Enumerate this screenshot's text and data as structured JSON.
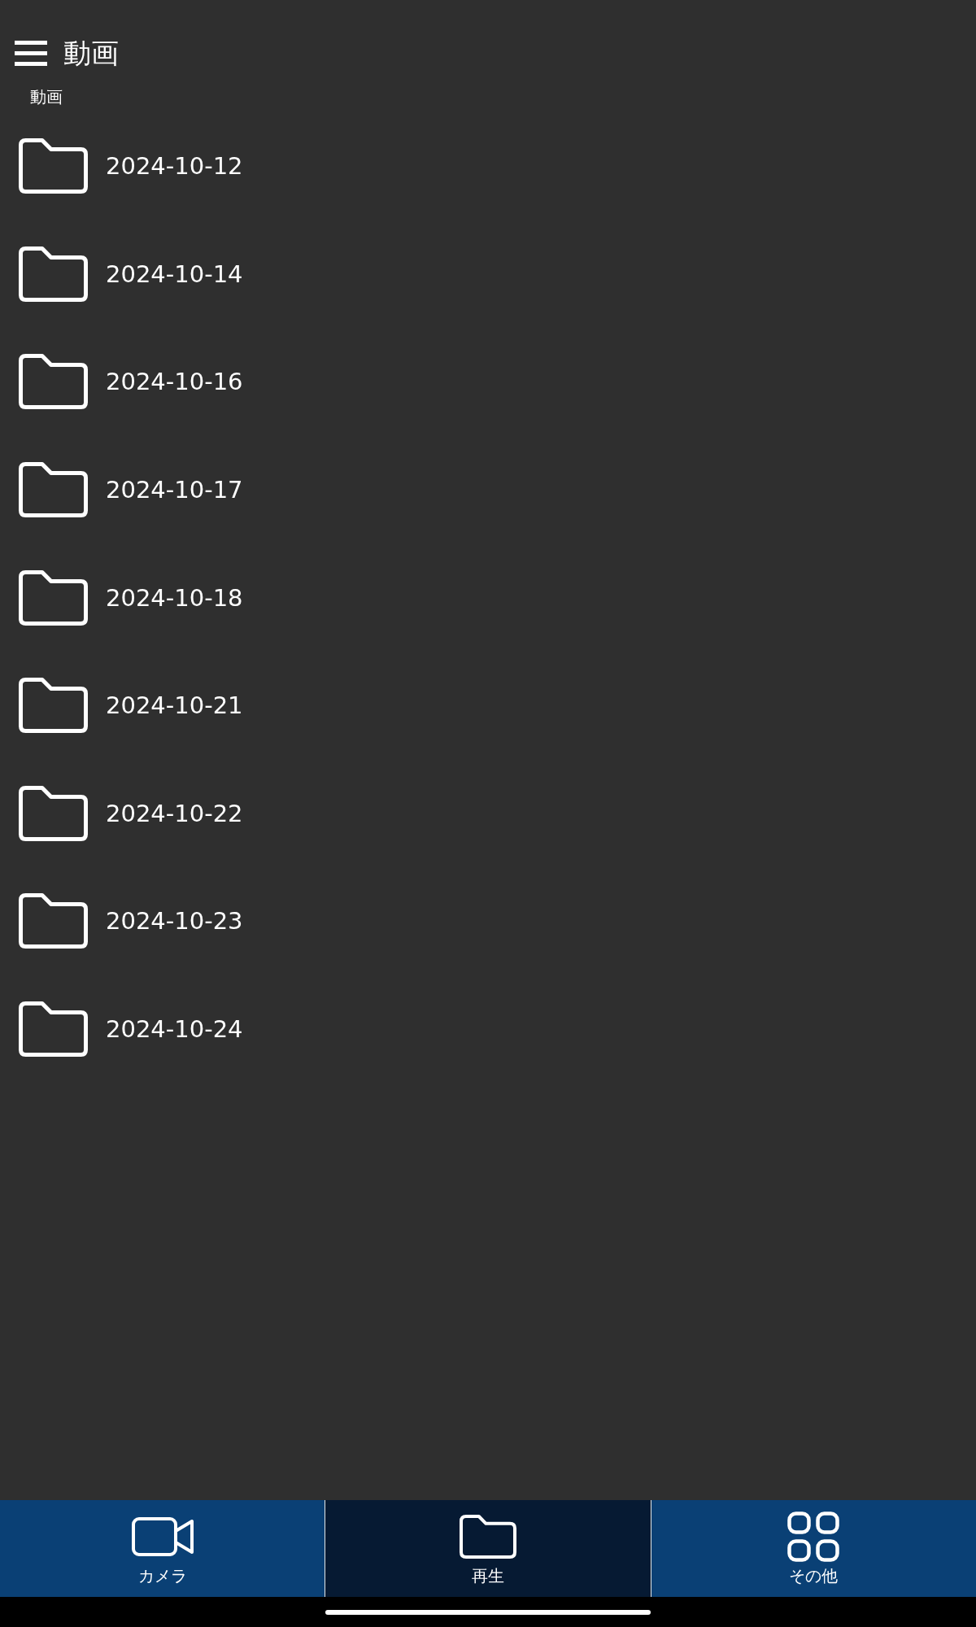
{
  "app_bar": {
    "title": "動画"
  },
  "breadcrumb": "動画",
  "folders": [
    {
      "name": "2024-10-12"
    },
    {
      "name": "2024-10-14"
    },
    {
      "name": "2024-10-16"
    },
    {
      "name": "2024-10-17"
    },
    {
      "name": "2024-10-18"
    },
    {
      "name": "2024-10-21"
    },
    {
      "name": "2024-10-22"
    },
    {
      "name": "2024-10-23"
    },
    {
      "name": "2024-10-24"
    }
  ],
  "bottom_nav": [
    {
      "label": "カメラ",
      "kind": "camera",
      "selected": false
    },
    {
      "label": "再生",
      "kind": "folder",
      "selected": true
    },
    {
      "label": "その他",
      "kind": "grid",
      "selected": false
    }
  ]
}
